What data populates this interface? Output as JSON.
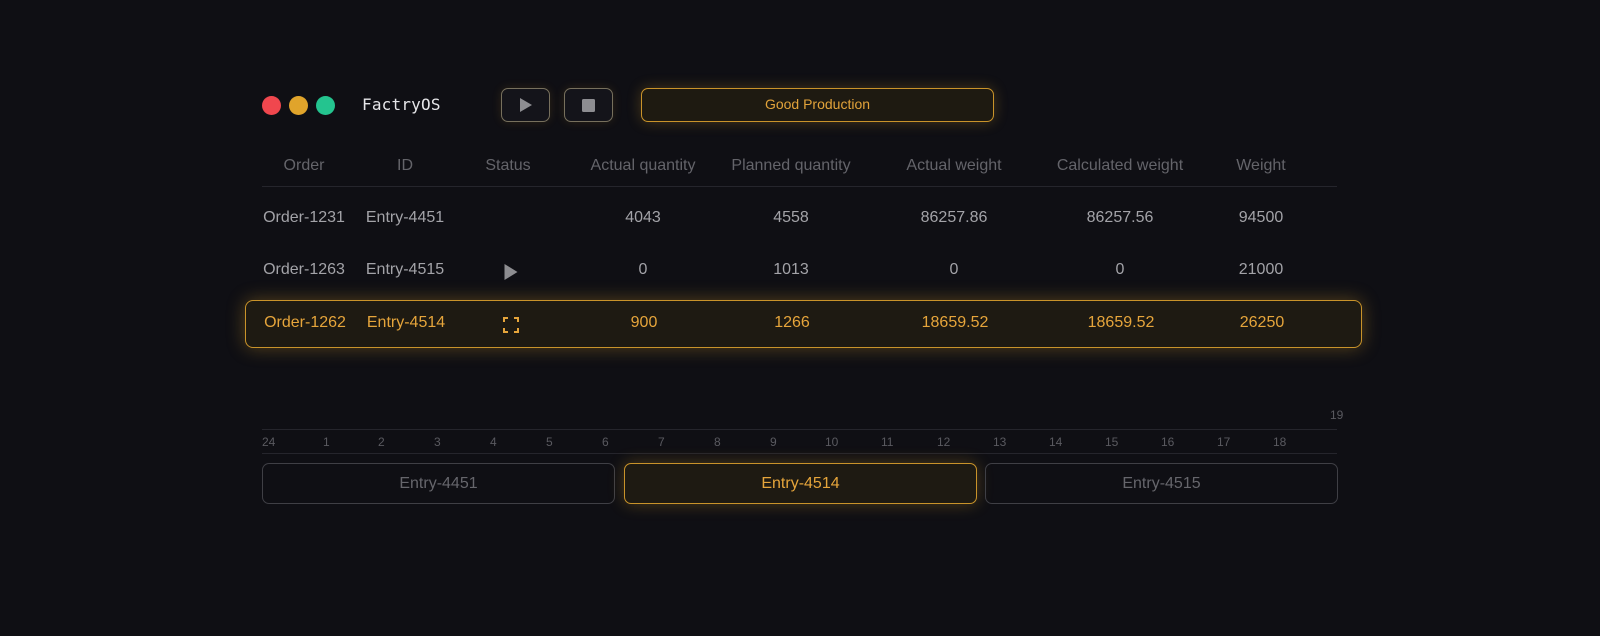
{
  "window": {
    "app_title": "FactryOS",
    "traffic_lights": {
      "close": "#f0474e",
      "minimize": "#e0a42b",
      "maximize": "#24c48f"
    }
  },
  "toolbar": {
    "play_icon": "play-icon",
    "stop_icon": "stop-icon",
    "status_label": "Good Production"
  },
  "colors": {
    "accent": "#e6a53b",
    "background": "#0f0f14",
    "muted_text": "#a3a3a8"
  },
  "table": {
    "columns": [
      "Order",
      "ID",
      "Status",
      "Actual quantity",
      "Planned quantity",
      "Actual weight",
      "Calculated weight",
      "Weight"
    ],
    "rows": [
      {
        "order": "Order-1231",
        "id": "Entry-4451",
        "status": "",
        "actual_quantity": "4043",
        "planned_quantity": "4558",
        "actual_weight": "86257.86",
        "calculated_weight": "86257.56",
        "weight": "94500"
      },
      {
        "order": "Order-1263",
        "id": "Entry-4515",
        "status": "play-icon",
        "actual_quantity": "0",
        "planned_quantity": "1013",
        "actual_weight": "0",
        "calculated_weight": "0",
        "weight": "21000"
      },
      {
        "order": "Order-1262",
        "id": "Entry-4514",
        "status": "focus-icon",
        "actual_quantity": "900",
        "planned_quantity": "1266",
        "actual_weight": "18659.52",
        "calculated_weight": "18659.52",
        "weight": "26250",
        "selected": true
      }
    ]
  },
  "timeline": {
    "top_label": "19",
    "ticks": [
      "24",
      "1",
      "2",
      "3",
      "4",
      "5",
      "6",
      "7",
      "8",
      "9",
      "10",
      "11",
      "12",
      "13",
      "14",
      "15",
      "16",
      "17",
      "18"
    ],
    "segments": [
      {
        "label": "Entry-4451",
        "active": false
      },
      {
        "label": "Entry-4514",
        "active": true
      },
      {
        "label": "Entry-4515",
        "active": false
      }
    ]
  }
}
